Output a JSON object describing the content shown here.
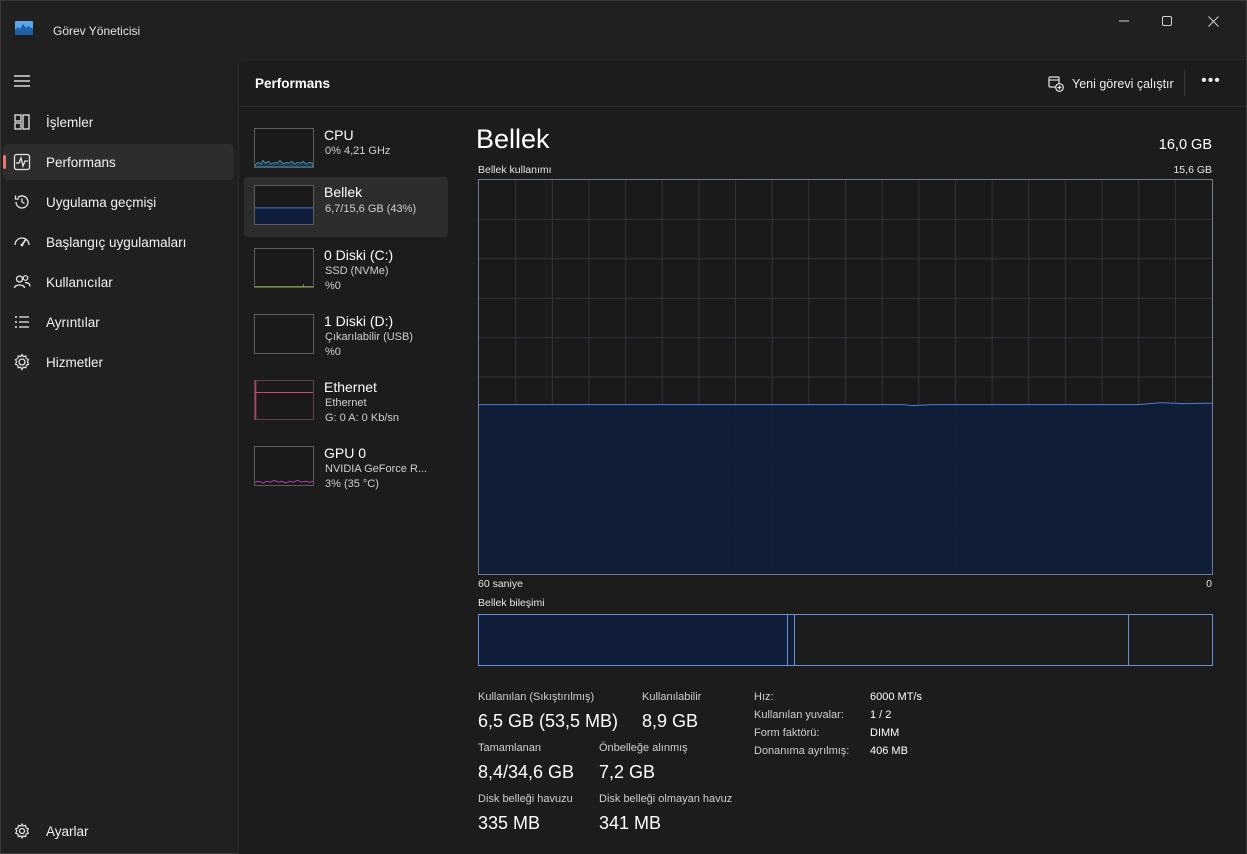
{
  "app": {
    "title": "Görev Yöneticisi"
  },
  "nav": {
    "items": [
      {
        "label": "İşlemler",
        "icon": "processes-icon"
      },
      {
        "label": "Performans",
        "icon": "performance-icon"
      },
      {
        "label": "Uygulama geçmişi",
        "icon": "history-icon"
      },
      {
        "label": "Başlangıç uygulamaları",
        "icon": "startup-icon"
      },
      {
        "label": "Kullanıcılar",
        "icon": "users-icon"
      },
      {
        "label": "Ayrıntılar",
        "icon": "details-icon"
      },
      {
        "label": "Hizmetler",
        "icon": "services-icon"
      }
    ],
    "settings": "Ayarlar",
    "active_index": 1
  },
  "header": {
    "title": "Performans",
    "run_task": "Yeni görevi çalıştır",
    "more": "•••"
  },
  "perf_list": [
    {
      "title": "CPU",
      "sub1": "0% 4,21 GHz",
      "sub2": "",
      "color": "#4aa3c7"
    },
    {
      "title": "Bellek",
      "sub1": "6,7/15,6 GB (43%)",
      "sub2": "",
      "color": "#4c7bd9"
    },
    {
      "title": "0 Diski (C:)",
      "sub1": "SSD (NVMe)",
      "sub2": "%0",
      "color": "#8fbf3f"
    },
    {
      "title": "1 Diski (D:)",
      "sub1": "Çıkarılabilir (USB)",
      "sub2": "%0",
      "color": "#8fbf3f"
    },
    {
      "title": "Ethernet",
      "sub1": "Ethernet",
      "sub2": "G: 0 A: 0 Kb/sn",
      "color": "#e0508a"
    },
    {
      "title": "GPU 0",
      "sub1": "NVIDIA GeForce R...",
      "sub2": "3% (35 °C)",
      "color": "#c040c0"
    }
  ],
  "memory": {
    "title": "Bellek",
    "total": "16,0 GB",
    "usage_label": "Bellek kullanımı",
    "usage_max": "15,6 GB",
    "axis_left": "60 saniye",
    "axis_right": "0",
    "composition_label": "Bellek bileşimi",
    "usage_fraction": 0.43,
    "stats": {
      "used_label": "Kullanılan (Sıkıştırılmış)",
      "used_value": "6,5 GB (53,5 MB)",
      "avail_label": "Kullanılabilir",
      "avail_value": "8,9 GB",
      "committed_label": "Tamamlanan",
      "committed_value": "8,4/34,6 GB",
      "cached_label": "Önbelleğe alınmış",
      "cached_value": "7,2 GB",
      "paged_label": "Disk belleği havuzu",
      "paged_value": "335 MB",
      "nonpaged_label": "Disk belleği olmayan havuz",
      "nonpaged_value": "341 MB"
    },
    "specs": [
      {
        "label": "Hız:",
        "value": "6000 MT/s"
      },
      {
        "label": "Kullanılan yuvalar:",
        "value": "1 / 2"
      },
      {
        "label": "Form faktörü:",
        "value": "DIMM"
      },
      {
        "label": "Donanıma ayrılmış:",
        "value": "406 MB"
      }
    ]
  },
  "colors": {
    "accent": "#e8756a",
    "memory_line": "#4c7bd9",
    "memory_fill": "#0f1d3a"
  }
}
